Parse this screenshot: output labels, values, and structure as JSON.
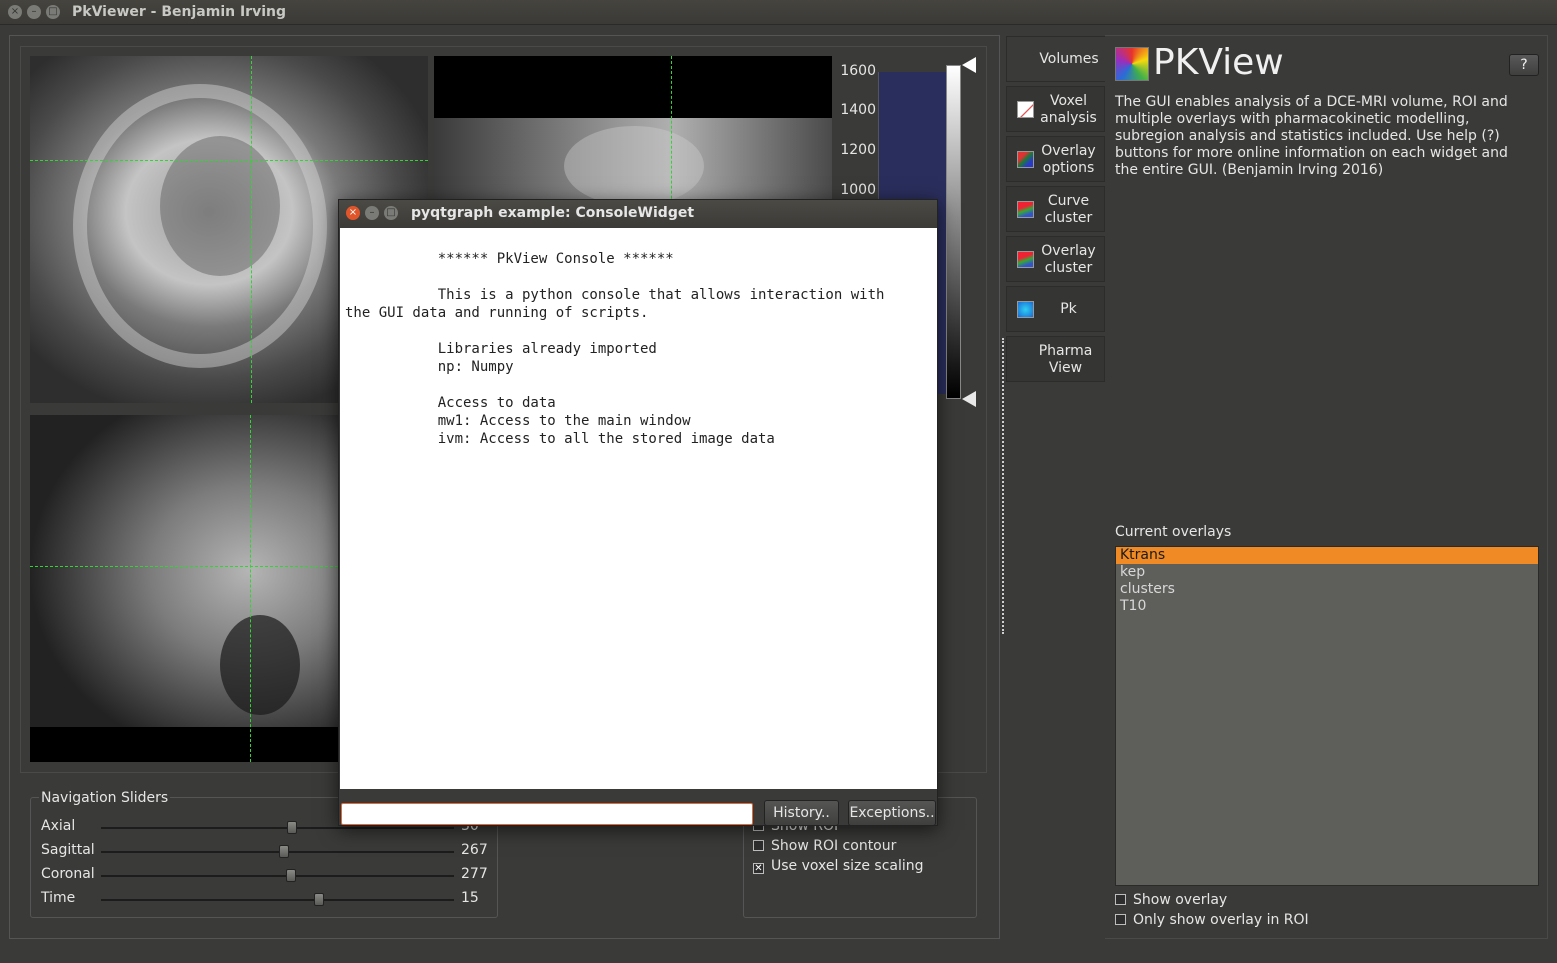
{
  "window": {
    "title": "PkViewer - Benjamin Irving",
    "close_glyph": "×",
    "min_glyph": "–",
    "max_glyph": "□"
  },
  "histogram": {
    "ticks": [
      "1600",
      "1400",
      "1200",
      "1000"
    ]
  },
  "navigation": {
    "title": "Navigation Sliders",
    "sliders": [
      {
        "label": "Axial",
        "value": "30",
        "fraction": 0.5
      },
      {
        "label": "Sagittal",
        "value": "267",
        "fraction": 0.52
      },
      {
        "label": "Coronal",
        "value": "277",
        "fraction": 0.54
      },
      {
        "label": "Time",
        "value": "15",
        "fraction": 0.62
      }
    ]
  },
  "view_options": {
    "show_roi": {
      "label": "Show ROI",
      "checked": false
    },
    "show_roi_contour": {
      "label": "Show ROI contour",
      "checked": false
    },
    "voxel_scaling": {
      "label": "Use voxel size scaling",
      "checked": true,
      "mark": "✕"
    }
  },
  "tabs": [
    {
      "label": "Volumes",
      "icon": "volumes-icon"
    },
    {
      "label": "Voxel analysis",
      "icon": "voxel-analysis-icon"
    },
    {
      "label": "Overlay options",
      "icon": "overlay-options-icon"
    },
    {
      "label": "Curve cluster",
      "icon": "curve-cluster-icon"
    },
    {
      "label": "Overlay cluster",
      "icon": "overlay-cluster-icon"
    },
    {
      "label": "Pk",
      "icon": "pk-icon"
    },
    {
      "label": "Pharma View",
      "icon": ""
    }
  ],
  "right_panel": {
    "app_title": "PKView",
    "help_label": "?",
    "description": "The GUI enables analysis of a DCE-MRI volume, ROI and multiple overlays with pharmacokinetic modelling, subregion analysis and statistics included. Use help (?) buttons for more online information on each widget and the entire GUI. (Benjamin Irving 2016)",
    "overlays_label": "Current overlays",
    "overlays": [
      "Ktrans",
      "kep",
      "clusters",
      "T10"
    ],
    "selected_overlay": "Ktrans",
    "show_overlay": {
      "label": "Show overlay",
      "checked": false
    },
    "only_in_roi": {
      "label": "Only show overlay in ROI",
      "checked": false
    }
  },
  "console": {
    "title": "pyqtgraph example: ConsoleWidget",
    "output": "           ****** PkView Console ******\n\n           This is a python console that allows interaction with\nthe GUI data and running of scripts.\n\n           Libraries already imported\n           np: Numpy\n\n           Access to data\n           mw1: Access to the main window\n           ivm: Access to all the stored image data",
    "input_value": "",
    "history_label": "History..",
    "exceptions_label": "Exceptions.."
  },
  "colors": {
    "accent": "#f08a24",
    "crosshair": "#31d431",
    "histogram": "#2a2e5c"
  }
}
